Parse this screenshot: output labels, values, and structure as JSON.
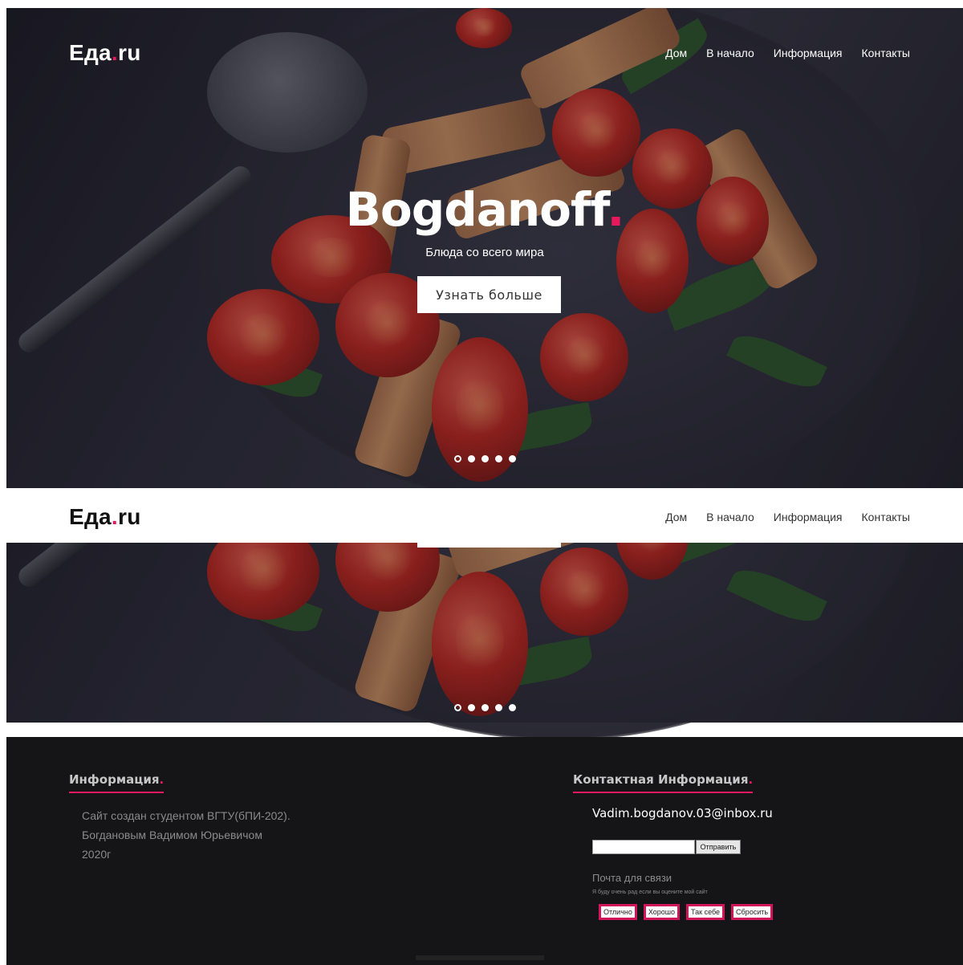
{
  "brand": {
    "name": "Еда",
    "tld": "ru",
    "accent": "#e8185c"
  },
  "nav": {
    "items": [
      "Дом",
      "В начало",
      "Информация",
      "Контакты"
    ]
  },
  "hero": {
    "title": "Bogdanoff",
    "subtitle": "Блюда со всего мира",
    "button_label": "Узнать больше",
    "slides_total": 5,
    "slide_active": 1
  },
  "footer": {
    "info_heading": "Информация",
    "info_lines": [
      "Сайт создан студентом ВГТУ(бПИ-202).",
      "Богдановым Вадимом Юрьевичом",
      "2020г"
    ],
    "contact_heading": "Контактная Информация",
    "email": "Vadim.bogdanov.03@inbox.ru",
    "send_label": "Отправить",
    "mail_label": "Почта для связи",
    "rating_question": "Я буду очень рад если вы оцените мой сайт",
    "rating_buttons": [
      "Отлично",
      "Хорошо",
      "Так себе",
      "Сбросить"
    ]
  }
}
